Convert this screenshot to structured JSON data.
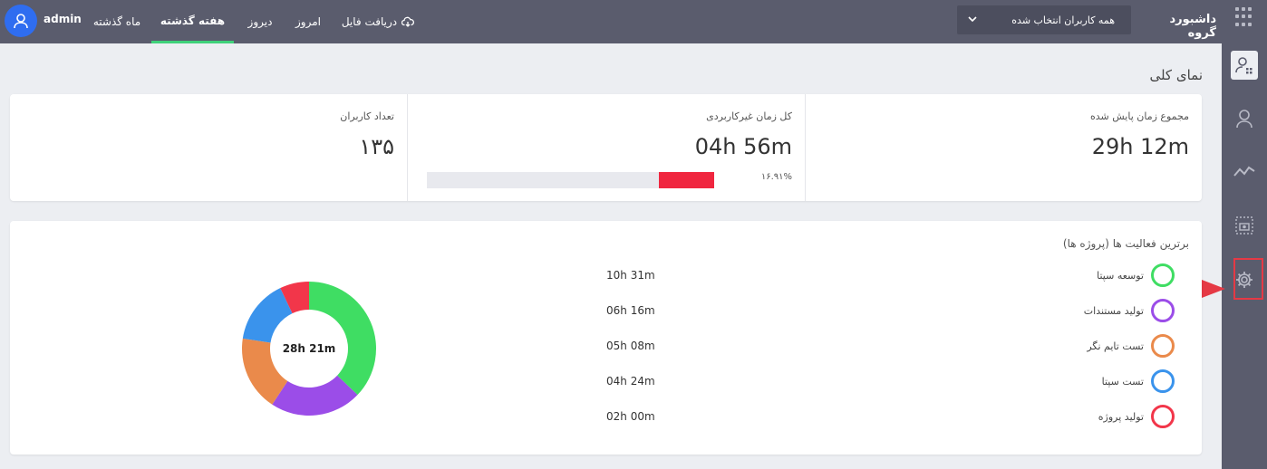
{
  "topbar": {
    "username": "admin",
    "tabs": [
      "ماه گذشته",
      "هفته گذشته",
      "دیروز",
      "امروز"
    ],
    "download_label": "دریافت فایل",
    "user_filter": "همه کاربران انتخاب شده",
    "dashboard_title": "داشبورد گروه"
  },
  "main": {
    "section_title": "نمای کلی",
    "stats": {
      "total_time_label": "مجموع زمان پایش شده",
      "total_time_value": "29h 12m",
      "idle_time_label": "کل زمان غیرکاربردی",
      "idle_time_value": "04h 56m",
      "idle_percent_label": "۱۶.۹۱%",
      "idle_fraction": 0.1691,
      "user_count_label": "تعداد کاربران",
      "user_count_value": "۱۳۵"
    },
    "activities": {
      "title": "برترین فعالیت ها (پروژه ها)",
      "total": "28h 21m",
      "items": [
        {
          "name": "توسعه سپتا",
          "time": "10h 31m",
          "color": "#3fdd63",
          "minutes": 631
        },
        {
          "name": "تولید مستندات",
          "time": "06h 16m",
          "color": "#9b4de8",
          "minutes": 376
        },
        {
          "name": "تست تایم نگر",
          "time": "05h 08m",
          "color": "#ea8a4b",
          "minutes": 308
        },
        {
          "name": "تست سپتا",
          "time": "04h 24m",
          "color": "#3a93ec",
          "minutes": 264
        },
        {
          "name": "تولید پروژه",
          "time": "02h 00m",
          "color": "#f2364a",
          "minutes": 120
        }
      ]
    }
  },
  "colors": {
    "topbar": "#5a5c6d",
    "active_tab": "#3fd17a",
    "idle_bar": "#f0263f",
    "highlight": "#e53945"
  }
}
